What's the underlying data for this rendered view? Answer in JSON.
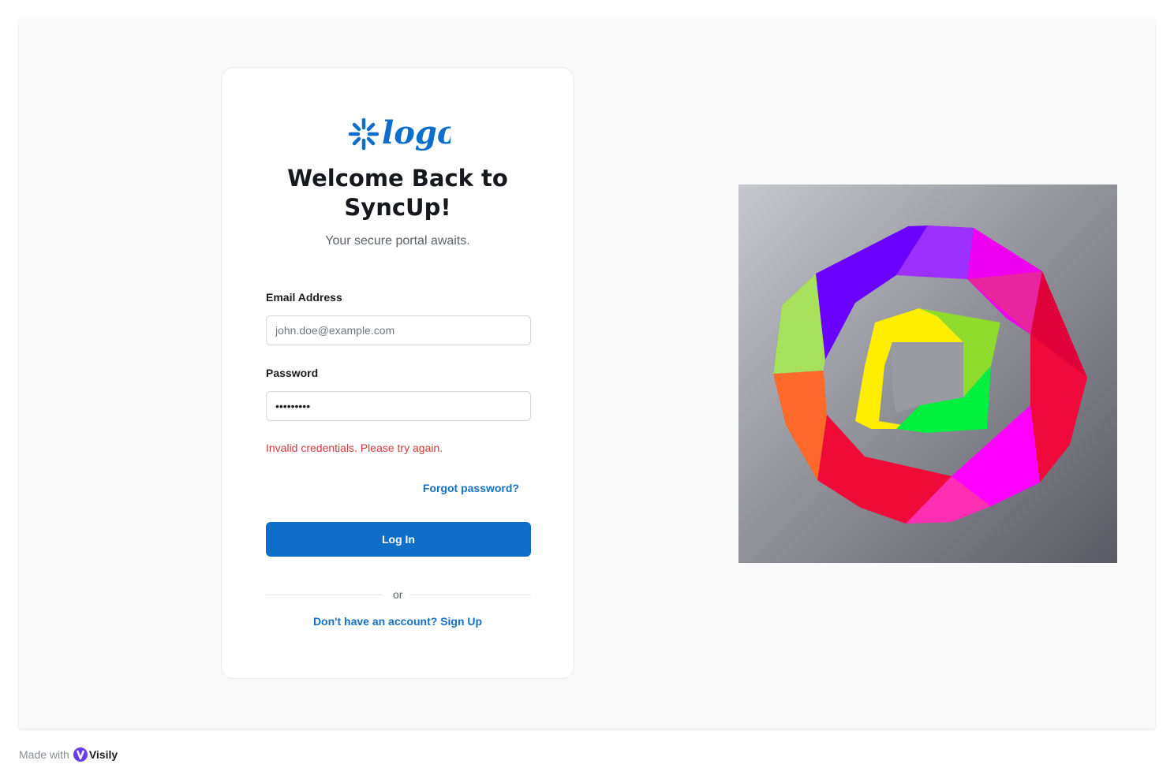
{
  "brand": {
    "logo_text": "logo",
    "logo_color": "#0d6ecb"
  },
  "login_card": {
    "title_line1": "Welcome Back to",
    "title_line2": "SyncUp!",
    "subtitle": "Your secure portal awaits.",
    "email": {
      "label": "Email Address",
      "placeholder": "john.doe@example.com",
      "value": ""
    },
    "password": {
      "label": "Password",
      "value": "password1"
    },
    "error_message": "Invalid credentials. Please try again.",
    "forgot_password_link": "Forgot password?",
    "login_button": "Log In",
    "divider_text": "or",
    "signup_link": "Don't have an account? Sign Up"
  },
  "hero_image": {
    "icon": "geometric-ring-illustration"
  },
  "footer": {
    "made_with": "Made with",
    "tool_name": "Visily"
  },
  "colors": {
    "primary": "#0f6ec8",
    "error": "#d23a3a",
    "page_background": "#f9f9f9"
  }
}
